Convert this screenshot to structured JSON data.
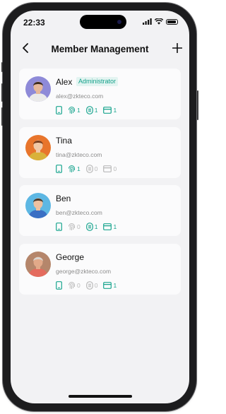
{
  "status_bar": {
    "time": "22:33"
  },
  "header": {
    "title": "Member Management"
  },
  "colors": {
    "accent": "#1aa58f",
    "inactive": "#b9b9b9",
    "badge_bg": "#e3f4f1"
  },
  "members": [
    {
      "name": "Alex",
      "role": "Administrator",
      "email": "alex@zkteco.com",
      "avatar": {
        "hair": "#3b2a1e",
        "shirt": "#eaeaea",
        "skin": "#e6b89a",
        "bg": "#8e8ad8"
      },
      "credentials": {
        "phone": {
          "icon": "phone-icon",
          "active": true
        },
        "fingerprint": {
          "icon": "fingerprint-icon",
          "count": "1",
          "active": true
        },
        "face": {
          "icon": "face-icon",
          "count": "1",
          "active": true
        },
        "card": {
          "icon": "card-icon",
          "count": "1",
          "active": true
        }
      }
    },
    {
      "name": "Tina",
      "role": "",
      "email": "tina@zkteco.com",
      "avatar": {
        "hair": "#7a3f1e",
        "shirt": "#d9b23a",
        "skin": "#f0c9a8",
        "bg": "#e8752c"
      },
      "credentials": {
        "phone": {
          "icon": "phone-icon",
          "active": true
        },
        "fingerprint": {
          "icon": "fingerprint-icon",
          "count": "1",
          "active": true
        },
        "face": {
          "icon": "face-icon",
          "count": "0",
          "active": false
        },
        "card": {
          "icon": "card-icon",
          "count": "0",
          "active": false
        }
      }
    },
    {
      "name": "Ben",
      "role": "",
      "email": "ben@zkteco.com",
      "avatar": {
        "hair": "#4a3728",
        "shirt": "#3a6fc4",
        "skin": "#eec1a0",
        "bg": "#5db7e3"
      },
      "credentials": {
        "phone": {
          "icon": "phone-icon",
          "active": true
        },
        "fingerprint": {
          "icon": "fingerprint-icon",
          "count": "0",
          "active": false
        },
        "face": {
          "icon": "face-icon",
          "count": "1",
          "active": true
        },
        "card": {
          "icon": "card-icon",
          "count": "1",
          "active": true
        }
      }
    },
    {
      "name": "George",
      "role": "",
      "email": "george@zkteco.com",
      "avatar": {
        "hair": "#d9d6d2",
        "shirt": "#e46b5e",
        "skin": "#e2a989",
        "bg": "#b5866b"
      },
      "credentials": {
        "phone": {
          "icon": "phone-icon",
          "active": true
        },
        "fingerprint": {
          "icon": "fingerprint-icon",
          "count": "0",
          "active": false
        },
        "face": {
          "icon": "face-icon",
          "count": "0",
          "active": false
        },
        "card": {
          "icon": "card-icon",
          "count": "1",
          "active": true
        }
      }
    }
  ]
}
